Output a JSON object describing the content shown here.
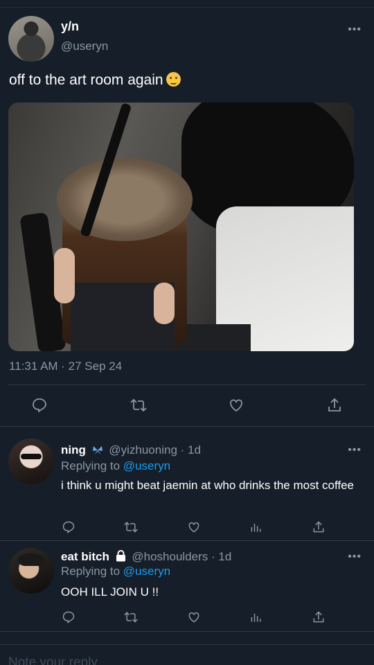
{
  "main": {
    "name": "y/n",
    "handle": "@useryn",
    "more": "•••",
    "text": "off to the art room again",
    "timestamp": "11:31 AM · 27 Sep 24"
  },
  "replies": [
    {
      "name": "ning",
      "handle": "@yizhuoning · 1d",
      "replying_prefix": "Replying to ",
      "mention": "@useryn",
      "text": "i think u might beat jaemin at who drinks the most coffee",
      "more": "•••"
    },
    {
      "name": "eat bitch",
      "handle": "@hoshoulders · 1d",
      "replying_prefix": "Replying to ",
      "mention": "@useryn",
      "text": "OOH ILL JOIN U !!",
      "more": "•••"
    }
  ],
  "compose": {
    "placeholder": "Note your reply"
  },
  "icons": {
    "main_actions": [
      "reply-icon",
      "retweet-icon",
      "like-icon",
      "share-icon"
    ],
    "reply_actions": [
      "reply-icon",
      "retweet-icon",
      "like-icon",
      "analytics-icon",
      "share-icon"
    ],
    "badges": [
      "butterfly-icon",
      "lock-icon"
    ]
  },
  "colors": {
    "background": "#151e29",
    "text": "#e7e9ea",
    "muted": "#8b98a5",
    "link": "#1d9bf0",
    "divider": "#2f3942"
  }
}
